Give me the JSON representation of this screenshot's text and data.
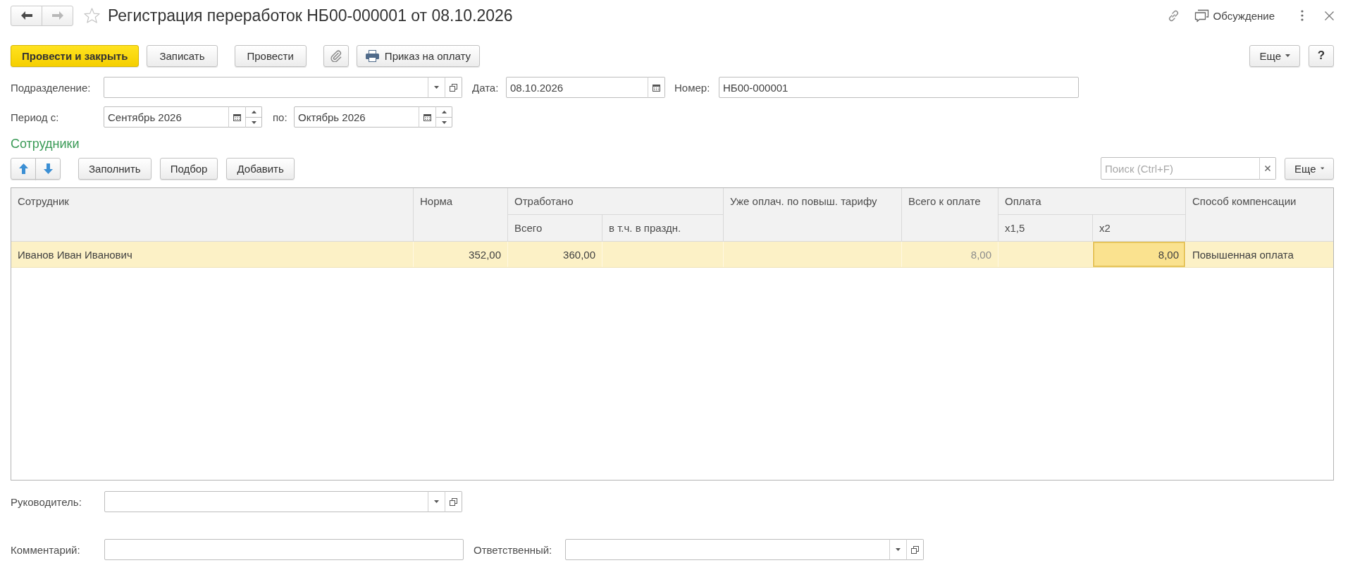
{
  "window": {
    "title": "Регистрация переработок НБ00-000001 от 08.10.2026",
    "favorite": false,
    "discussion": "Обсуждение"
  },
  "navigation": [
    {
      "kind": "back",
      "disabled": false
    },
    {
      "kind": "forward",
      "disabled": true
    }
  ],
  "toolbar": {
    "buttons": [
      {
        "kind": "primary",
        "label": "Провести и закрыть"
      },
      {
        "kind": "default",
        "label": "Записать"
      },
      {
        "kind": "default",
        "label": "Провести"
      },
      {
        "kind": "attach"
      },
      {
        "kind": "print",
        "label": "Приказ на оплату"
      }
    ],
    "more": "Еще",
    "help": "?"
  },
  "header": {
    "subdivision": {
      "label": "Подразделение:"
    },
    "date": {
      "label": "Дата:",
      "value": "08.10.2026"
    },
    "number": {
      "label": "Номер:",
      "value": "НБ00-000001"
    },
    "period": {
      "label": "Период с:",
      "from": "Сентябрь 2026",
      "to_label": "по:",
      "to": "Октябрь 2026"
    }
  },
  "employees": {
    "title": "Сотрудники",
    "move_buttons": [
      {
        "kind": "up"
      },
      {
        "kind": "down"
      }
    ],
    "buttons": [
      "Заполнить",
      "Подбор",
      "Добавить"
    ],
    "search": {
      "placeholder": "Поиск (Ctrl+F)"
    },
    "more": "Еще",
    "table": {
      "columns": [
        {
          "label": "Сотрудник",
          "kind": "text"
        },
        {
          "label": "Норма",
          "kind": "number"
        },
        {
          "label": "Отработано",
          "children": [
            {
              "label": "Всего",
              "kind": "number"
            },
            {
              "label": "в т.ч. в праздн.",
              "kind": "number"
            }
          ]
        },
        {
          "label": "Уже оплач. по повыш. тарифу",
          "kind": "number"
        },
        {
          "label": "Всего к оплате",
          "kind": "number"
        },
        {
          "label": "Оплата",
          "children": [
            {
              "label": "x1,5",
              "kind": "number"
            },
            {
              "label": "x2",
              "kind": "number"
            }
          ]
        },
        {
          "label": "Способ компенсации",
          "kind": "text"
        }
      ],
      "rows": [
        {
          "selected": true,
          "cells": [
            {
              "text": "Иванов Иван Иванович",
              "muted": false,
              "selected": false
            },
            {
              "text": "352,00",
              "muted": false,
              "selected": false
            },
            {
              "text": "360,00",
              "muted": false,
              "selected": false
            },
            {
              "selected": false
            },
            {
              "selected": false
            },
            {
              "text": "8,00",
              "muted": true,
              "selected": false
            },
            {
              "selected": false
            },
            {
              "text": "8,00",
              "muted": false,
              "selected": true
            },
            {
              "text": "Повышенная оплата",
              "muted": false,
              "selected": false
            }
          ]
        }
      ]
    }
  },
  "footer": {
    "manager": {
      "label": "Руководитель:"
    },
    "comment": {
      "label": "Комментарий:"
    },
    "responsible": {
      "label": "Ответственный:"
    }
  }
}
